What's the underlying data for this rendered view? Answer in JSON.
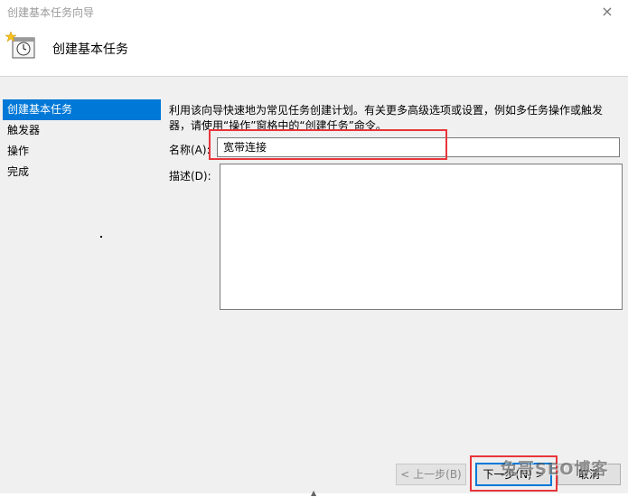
{
  "window": {
    "title": "创建基本任务向导",
    "close_glyph": "×"
  },
  "header": {
    "title": "创建基本任务",
    "icon": "task-clock-icon"
  },
  "sidebar": {
    "items": [
      {
        "label": "创建基本任务",
        "active": true
      },
      {
        "label": "触发器",
        "active": false
      },
      {
        "label": "操作",
        "active": false
      },
      {
        "label": "完成",
        "active": false
      }
    ]
  },
  "main": {
    "intro": "利用该向导快速地为常见任务创建计划。有关更多高级选项或设置，例如多任务操作或触发器，请使用“操作”窗格中的“创建任务”命令。",
    "name_label": "名称(A):",
    "name_value": "宽带连接",
    "description_label": "描述(D):",
    "description_value": ""
  },
  "buttons": {
    "back": "< 上一步(B)",
    "next": "下一步(N) >",
    "cancel": "取消"
  },
  "watermark": "兔哥SEO博客",
  "colors": {
    "accent": "#0078d7",
    "highlight": "#e8353a"
  }
}
